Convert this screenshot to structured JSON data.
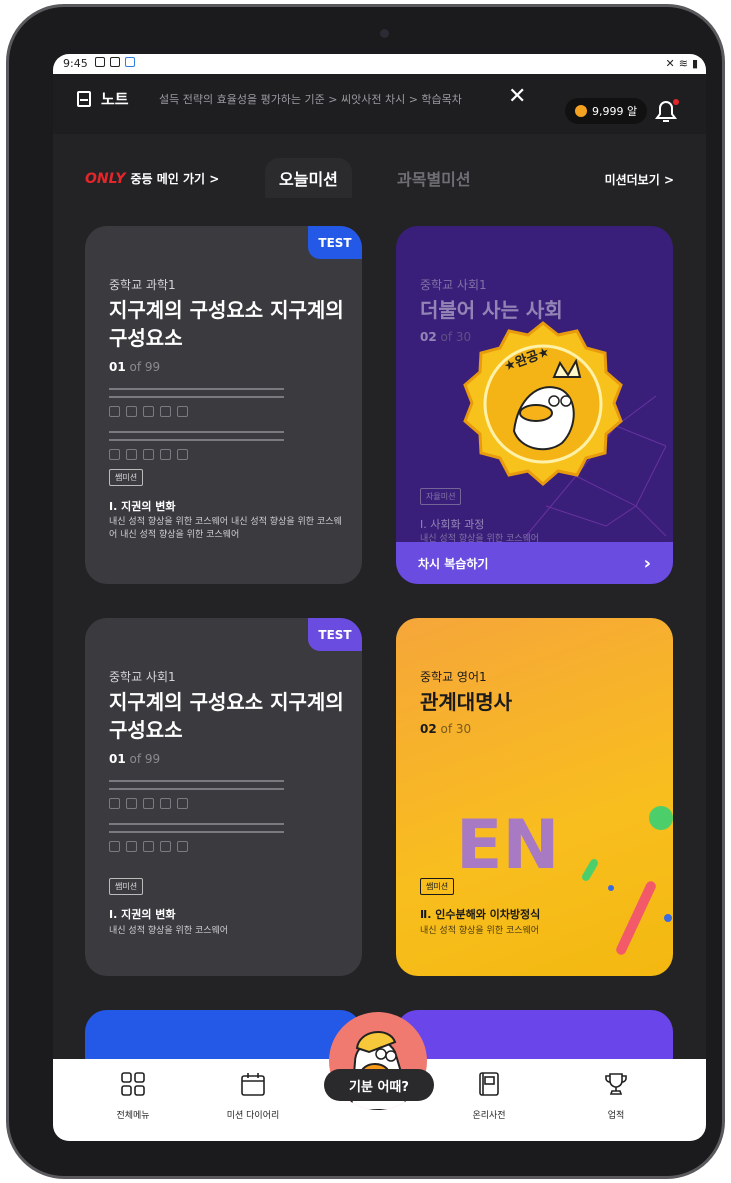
{
  "status_bar": {
    "time": "9:45"
  },
  "header": {
    "note_label": "노트",
    "breadcrumb": "설득 전략의 효율성을 평가하는 기준 > 씨앗사전 차시 > 학습목차",
    "coins": "9,999 알"
  },
  "tabs": {
    "only_logo": "ONLY",
    "main_link": "중등 메인 가기 >",
    "today": "오늘미션",
    "subject": "과목별미션",
    "more": "미션더보기 >"
  },
  "cards": [
    {
      "badge": "TEST",
      "subject": "중학교 과학1",
      "title": "지구계의 구성요소 지구계의 구성요소",
      "count_cur": "01",
      "count_total": "of 99",
      "tag": "쌤미션",
      "unit": "Ⅰ. 지권의 변화",
      "desc": "내신 성적 향상을 위한 코스웨어 내신 성적 향상을 위한 코스웨어 내신 성적 향상을 위한 코스웨어"
    },
    {
      "subject": "중학교 사회1",
      "title": "더불어 사는 사회",
      "count_cur": "02",
      "count_total": "of 30",
      "tag": "자율미션",
      "unit": "Ⅰ. 사회화 과정",
      "desc": "내신 성적 향상을 위한 코스웨어",
      "stamp": "★완공★",
      "review": "차시 복습하기"
    },
    {
      "badge": "TEST",
      "subject": "중학교 사회1",
      "title": "지구계의 구성요소 지구계의 구성요소",
      "count_cur": "01",
      "count_total": "of 99",
      "tag": "쌤미션",
      "unit": "Ⅰ. 지권의 변화",
      "desc": "내신 성적 향상을 위한 코스웨어"
    },
    {
      "subject": "중학교 영어1",
      "title": "관계대명사",
      "count_cur": "02",
      "count_total": "of 30",
      "tag": "쌤미션",
      "unit": "Ⅱ. 인수분해와 이차방정식",
      "desc": "내신 성적 향상을 위한 코스웨어",
      "art": "EN"
    }
  ],
  "nav": {
    "all_menu": "전체메뉴",
    "diary": "미션 다이어리",
    "mood": "기분 어때?",
    "dictionary": "온리사전",
    "achievement": "업적"
  },
  "colors": {
    "accent_blue": "#2459e7",
    "accent_purple": "#6a4de0",
    "accent_yellow": "#f8be1e",
    "bell_dot": "#e3262a"
  }
}
